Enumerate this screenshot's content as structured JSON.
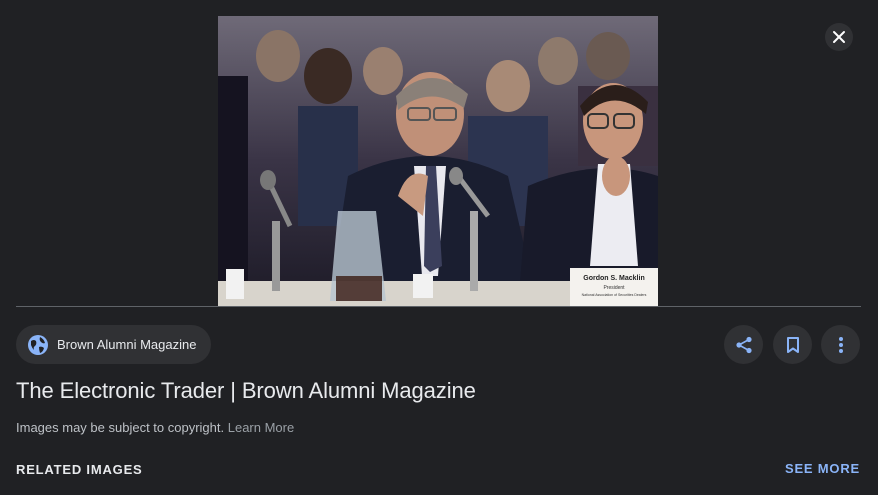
{
  "image": {
    "alt": "Gordon S. Macklin testifying at a hearing",
    "placard_name": "Gordon S. Macklin",
    "placard_line2": "President",
    "placard_line3": "National Association of Securities Dealers"
  },
  "source": {
    "name": "Brown Alumni Magazine",
    "icon": "globe-icon"
  },
  "actions": {
    "share_icon": "share-icon",
    "save_icon": "bookmark-icon",
    "more_icon": "more-vert-icon",
    "close_icon": "close-icon"
  },
  "title": "The Electronic Trader | Brown Alumni Magazine",
  "copyright": {
    "text": "Images may be subject to copyright.",
    "link": "Learn More"
  },
  "related": {
    "heading": "RELATED IMAGES",
    "see_more": "SEE MORE"
  },
  "colors": {
    "background": "#202124",
    "chip": "#303134",
    "accent": "#8ab4f8",
    "globe": "#8ab4f8"
  }
}
